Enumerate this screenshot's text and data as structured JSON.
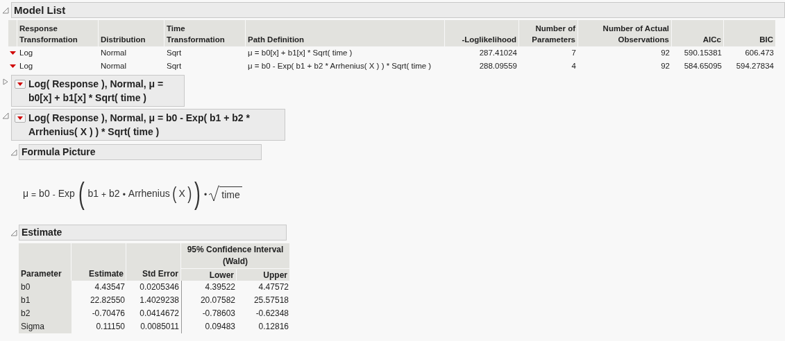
{
  "model_list": {
    "title": "Model List",
    "expanded": true,
    "columns": [
      "Response Transformation",
      "Distribution",
      "Time Transformation",
      "Path Definition",
      "-Loglikelihood",
      "Number of Parameters",
      "Number of Actual Observations",
      "AICc",
      "BIC"
    ],
    "rows": [
      [
        "Log",
        "Normal",
        "Sqrt",
        "μ = b0[x] + b1[x] * Sqrt( time )",
        "287.41024",
        "7",
        "92",
        "590.15381",
        "606.473"
      ],
      [
        "Log",
        "Normal",
        "Sqrt",
        "μ = b0 - Exp( b1 + b2 * Arrhenius( X ) ) * Sqrt( time )",
        "288.09559",
        "4",
        "92",
        "584.65095",
        "594.27834"
      ]
    ]
  },
  "models": [
    {
      "title": "Log( Response ), Normal, μ = b0[x] + b1[x] * Sqrt( time )",
      "expanded": false
    },
    {
      "title": "Log( Response ), Normal, μ = b0 - Exp( b1 + b2 * Arrhenius( X ) ) * Sqrt( time )",
      "expanded": true
    }
  ],
  "formula_picture": {
    "title": "Formula Picture",
    "expanded": true,
    "tokens": [
      {
        "kind": "sym",
        "text": "μ"
      },
      {
        "kind": "op",
        "text": "="
      },
      {
        "kind": "sym",
        "text": "b0"
      },
      {
        "kind": "op",
        "text": "-"
      },
      {
        "kind": "sym",
        "text": "Exp"
      },
      {
        "kind": "big",
        "text": "("
      },
      {
        "kind": "sym",
        "text": "b1"
      },
      {
        "kind": "op",
        "text": "+"
      },
      {
        "kind": "sym",
        "text": "b2"
      },
      {
        "kind": "op",
        "text": "•"
      },
      {
        "kind": "sym",
        "text": "Arrhenius"
      },
      {
        "kind": "mid",
        "text": "("
      },
      {
        "kind": "sym",
        "text": "X"
      },
      {
        "kind": "mid",
        "text": ")"
      },
      {
        "kind": "big",
        "text": ")"
      },
      {
        "kind": "op",
        "text": "•"
      },
      {
        "kind": "sqrt",
        "text": "time"
      }
    ]
  },
  "estimate": {
    "title": "Estimate",
    "expanded": true,
    "group_header": "95% Confidence Interval (Wald)",
    "columns": [
      "Parameter",
      "Estimate",
      "Std Error",
      "Lower",
      "Upper"
    ],
    "rows": [
      [
        "b0",
        "4.43547",
        "0.0205346",
        "4.39522",
        "4.47572"
      ],
      [
        "b1",
        "22.82550",
        "1.4029238",
        "20.07582",
        "25.57518"
      ],
      [
        "b2",
        "-0.70476",
        "0.0414672",
        "-0.78603",
        "-0.62348"
      ],
      [
        "Sigma",
        "0.11150",
        "0.0085011",
        "0.09483",
        "0.12816"
      ]
    ]
  }
}
